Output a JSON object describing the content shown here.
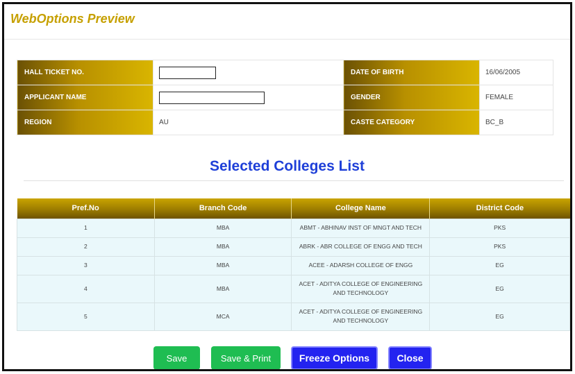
{
  "window": {
    "title": "WebOptions Preview"
  },
  "applicant": {
    "hall_ticket_label": "HALL TICKET NO.",
    "hall_ticket_value": "",
    "dob_label": "DATE OF BIRTH",
    "dob_value": "16/06/2005",
    "name_label": "APPLICANT NAME",
    "name_value": "",
    "gender_label": "GENDER",
    "gender_value": "FEMALE",
    "region_label": "REGION",
    "region_value": "AU",
    "caste_label": "CASTE CATEGORY",
    "caste_value": "BC_B"
  },
  "colleges": {
    "title": "Selected Colleges List",
    "headers": [
      "Pref.No",
      "Branch Code",
      "College Name",
      "District Code"
    ],
    "rows": [
      {
        "pref": "1",
        "branch": "MBA",
        "college": "ABMT - ABHINAV INST OF MNGT AND TECH",
        "district": "PKS"
      },
      {
        "pref": "2",
        "branch": "MBA",
        "college": "ABRK - ABR COLLEGE OF ENGG AND TECH",
        "district": "PKS"
      },
      {
        "pref": "3",
        "branch": "MBA",
        "college": "ACEE - ADARSH COLLEGE OF ENGG",
        "district": "EG"
      },
      {
        "pref": "4",
        "branch": "MBA",
        "college": "ACET - ADITYA COLLEGE OF ENGINEERING AND TECHNOLOGY",
        "district": "EG"
      },
      {
        "pref": "5",
        "branch": "MCA",
        "college": "ACET - ADITYA COLLEGE OF ENGINEERING AND TECHNOLOGY",
        "district": "EG"
      }
    ]
  },
  "buttons": {
    "save": "Save",
    "save_print": "Save & Print",
    "freeze": "Freeze Options",
    "close": "Close"
  },
  "colors": {
    "title": "#c6a000",
    "section_title": "#1e3fd8",
    "save_green": "#1fbd52",
    "primary_blue": "#2323f0"
  }
}
